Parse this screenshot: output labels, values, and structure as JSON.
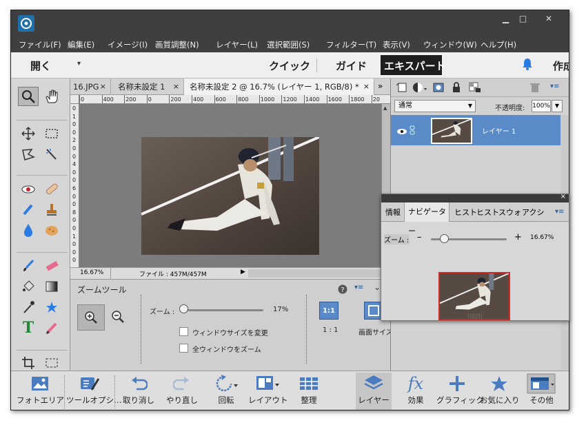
{
  "menu": [
    "ファイル(F)",
    "編集(E)",
    "イメージ(I)",
    "画質調整(N)",
    "レイヤー(L)",
    "選択範囲(S)",
    "フィルター(T)",
    "表示(V)",
    "ウィンドウ(W)",
    "ヘルプ(H)"
  ],
  "window_controls": {
    "minimize": "▁",
    "maximize": "□",
    "close": "✕"
  },
  "modebar": {
    "open": "開く",
    "modes": [
      "クイック",
      "ガイド",
      "エキスパート"
    ],
    "active_mode": "エキスパート",
    "create": "作成"
  },
  "tabs": [
    {
      "label": "16.JPG",
      "close": "×"
    },
    {
      "label": "名称未設定 1",
      "close": "×"
    },
    {
      "label": "名称未設定 2 @ 16.7% (レイヤー 1, RGB/8) *",
      "close": "×"
    }
  ],
  "tab_overflow": "»",
  "ruler_h": [
    "0",
    "400",
    "200",
    "0",
    "200",
    "400",
    "600",
    "800",
    "1000",
    "1200",
    "1400",
    "1600",
    "1800",
    "20"
  ],
  "ruler_v": [
    "0",
    "1",
    "0",
    "0",
    "2",
    "0",
    "0",
    "4",
    "0",
    "0",
    "6",
    "0",
    "0",
    "8",
    "0",
    "0",
    "1",
    "0",
    "0",
    "0"
  ],
  "status": {
    "zoom": "16.67%",
    "file": "ファイル : 457M/457M"
  },
  "tool_options": {
    "title": "ズームツール",
    "zoom_label": "ズーム :",
    "zoom_value": "17%",
    "zoom_fraction": 0.0,
    "resize_window": "ウィンドウサイズを変更",
    "zoom_all": "全ウィンドウをズーム",
    "actual_pixels": "1:1",
    "actual_pixels_label": "1 : 1",
    "fit_screen_label": "画面サイズ"
  },
  "layers": {
    "blend_mode": "通常",
    "opacity_label": "不透明度:",
    "opacity_value": "100%",
    "layer_name": "レイヤー 1"
  },
  "navigator": {
    "tabs": [
      "情報",
      "ナビゲーター",
      "ヒスト",
      "ヒスト",
      "スウォ",
      "アクシ"
    ],
    "active_tab": "ナビゲーター",
    "zoom_label": "ズーム :",
    "zoom_value": "16.67%",
    "zoom_fraction": 0.15,
    "minus": "–",
    "plus": "+"
  },
  "bottombar": [
    {
      "label": "フォトエリア",
      "icon": "photo-bin-icon"
    },
    {
      "label": "ツールオプシ…",
      "icon": "tool-options-icon"
    },
    {
      "label": "取り消し",
      "icon": "undo-icon"
    },
    {
      "label": "やり直し",
      "icon": "redo-icon"
    },
    {
      "label": "回転",
      "icon": "rotate-icon"
    },
    {
      "label": "レイアウト",
      "icon": "layout-icon"
    },
    {
      "label": "整理",
      "icon": "organizer-icon"
    },
    {
      "label": "レイヤー",
      "icon": "layers-icon"
    },
    {
      "label": "効果",
      "icon": "fx-icon"
    },
    {
      "label": "グラフィック",
      "icon": "graphics-icon"
    },
    {
      "label": "お気に入り",
      "icon": "favorites-icon"
    },
    {
      "label": "その他",
      "icon": "more-icon"
    }
  ],
  "effects_glyph": "fx",
  "text_tool_glyph": "T",
  "colors": {
    "accent": "#4a7cbf",
    "selected_layer": "#5b8ac9",
    "mode_active_bg": "#1e1e1e"
  }
}
